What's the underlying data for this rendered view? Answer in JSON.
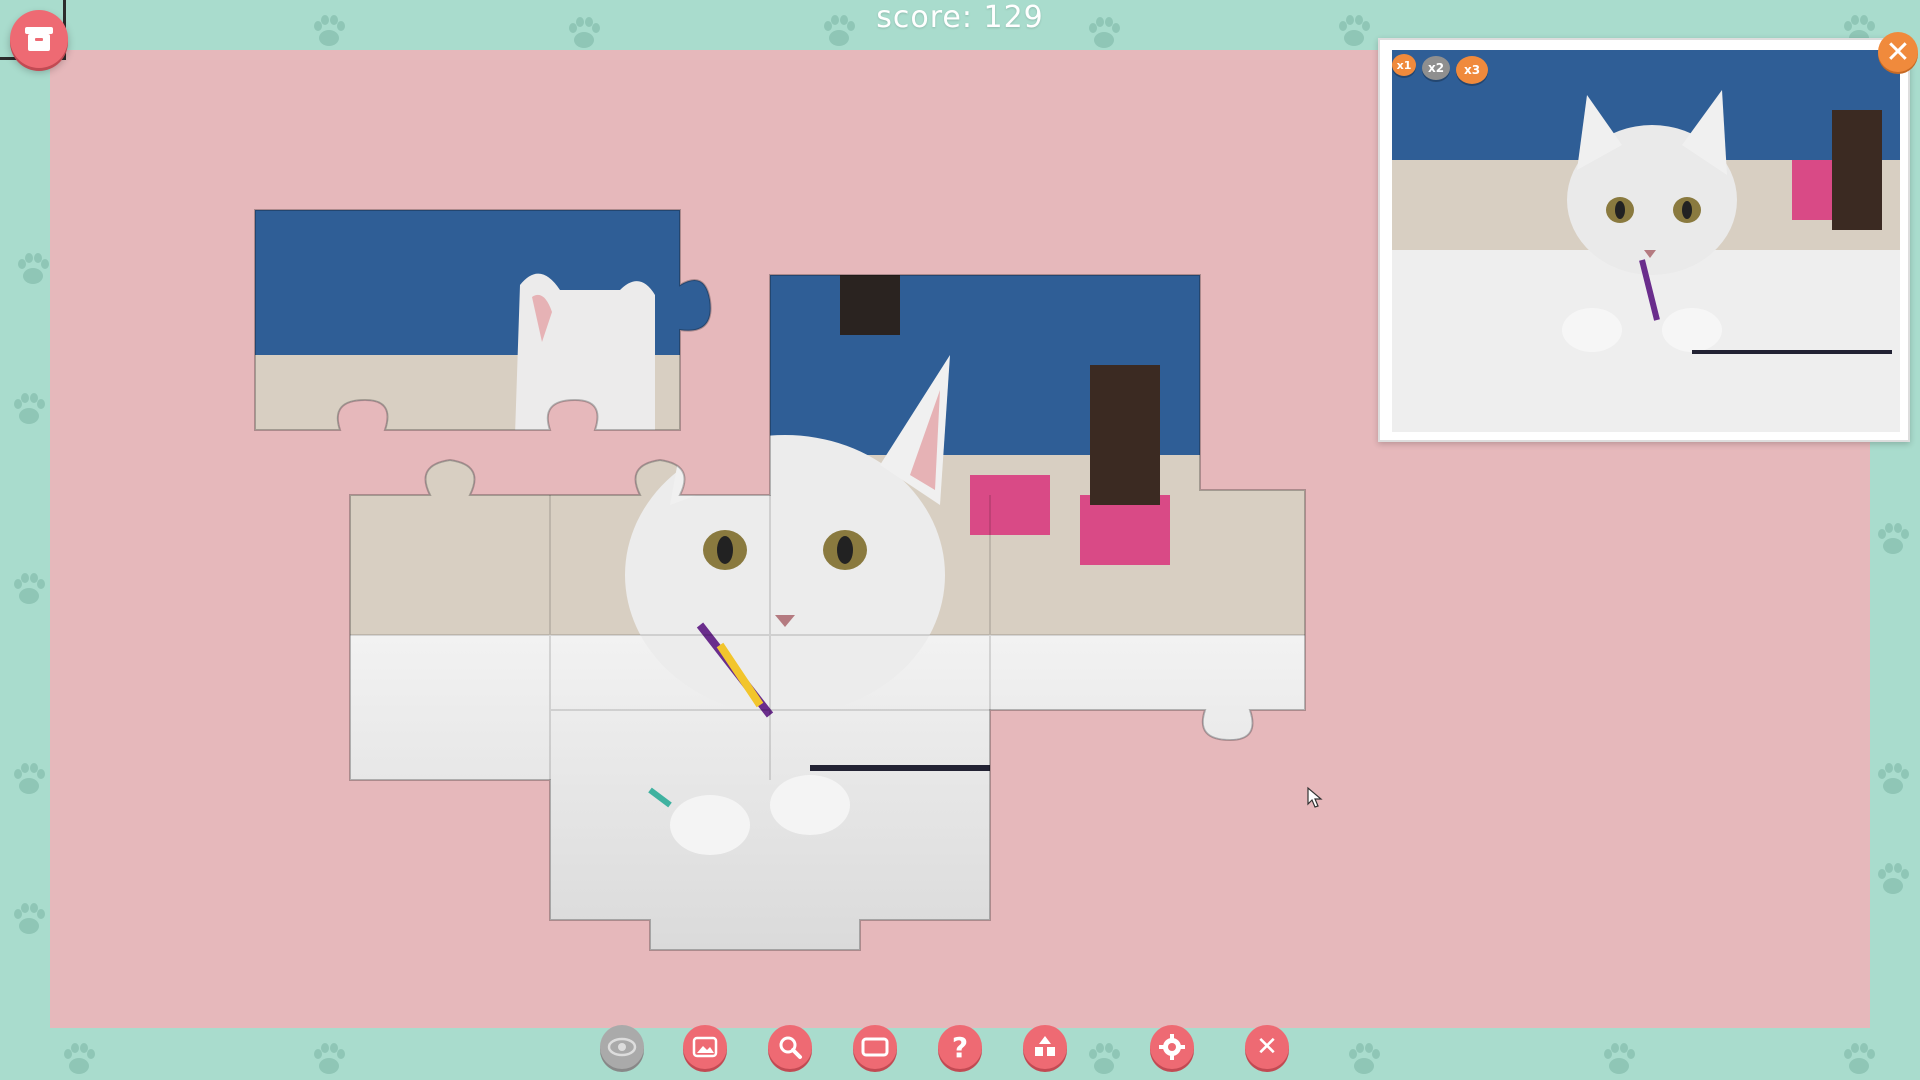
{
  "game": {
    "score_text": "score: 129"
  },
  "colors": {
    "background": "#a9dccd",
    "board": "#e6b8bb",
    "accent": "#ee6a73",
    "close_orange": "#f08a3c"
  },
  "preview": {
    "speed_badges": [
      "x1",
      "x2",
      "x3"
    ],
    "close_icon": "close-icon"
  },
  "toolbar": {
    "buttons": [
      {
        "name": "eye-icon",
        "state": "disabled"
      },
      {
        "name": "image-icon",
        "state": "enabled"
      },
      {
        "name": "magnifier-icon",
        "state": "enabled"
      },
      {
        "name": "fullscreen-icon",
        "state": "enabled"
      },
      {
        "name": "help-icon",
        "state": "enabled"
      },
      {
        "name": "shapes-icon",
        "state": "enabled"
      },
      {
        "name": "gear-icon",
        "state": "enabled"
      },
      {
        "name": "close-icon",
        "state": "enabled"
      }
    ]
  },
  "top_left_button": {
    "icon": "box-icon"
  }
}
